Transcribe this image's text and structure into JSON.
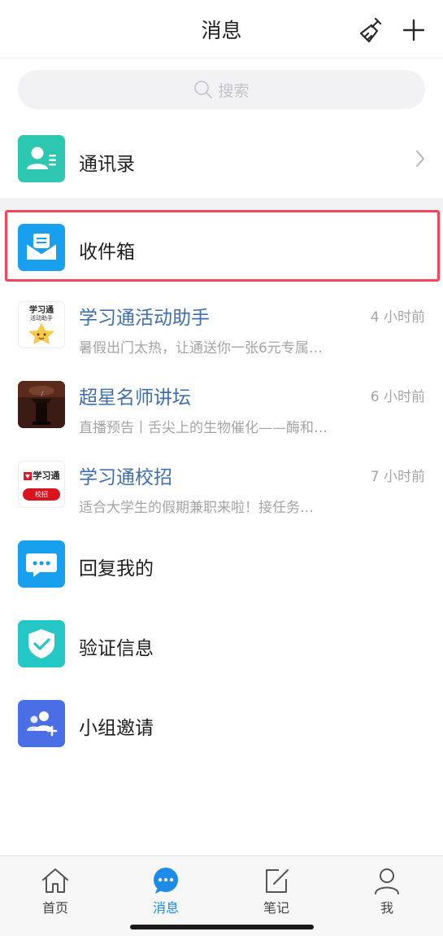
{
  "header": {
    "title": "消息",
    "broom_icon": "broom-icon",
    "plus_icon": "plus-icon"
  },
  "search": {
    "placeholder": "搜索",
    "icon": "search-icon"
  },
  "contacts": {
    "label": "通讯录",
    "icon": "contacts-icon",
    "color": "#2dc6b0"
  },
  "inbox": {
    "label": "收件箱",
    "icon": "inbox-envelope-icon",
    "color": "#18a0ee",
    "highlight_color": "#f0485a"
  },
  "messages": [
    {
      "title": "学习通活动助手",
      "time": "4 小时前",
      "preview": "暑假出门太热，让通送你一张6元专属…",
      "avatar_text": "学习通",
      "avatar_sub": "活动助手"
    },
    {
      "title": "超星名师讲坛",
      "time": "6 小时前",
      "preview": "直播预告丨舌尖上的生物催化——酶和…"
    },
    {
      "title": "学习通校招",
      "time": "7 小时前",
      "preview": "适合大学生的假期兼职来啦！接任务…",
      "avatar_text": "学习通",
      "avatar_sub": "校招"
    }
  ],
  "features": [
    {
      "label": "回复我的",
      "icon": "chat-bubble-icon",
      "color": "#18a0ee"
    },
    {
      "label": "验证信息",
      "icon": "shield-check-icon",
      "color": "#25c6c6"
    },
    {
      "label": "小组邀请",
      "icon": "group-invite-icon",
      "color": "#4a6ee6"
    }
  ],
  "tabbar": {
    "items": [
      {
        "label": "首页",
        "icon": "home-icon"
      },
      {
        "label": "消息",
        "icon": "message-icon",
        "active": true
      },
      {
        "label": "笔记",
        "icon": "note-icon"
      },
      {
        "label": "我",
        "icon": "profile-icon"
      }
    ],
    "active_color": "#1e8be8"
  }
}
